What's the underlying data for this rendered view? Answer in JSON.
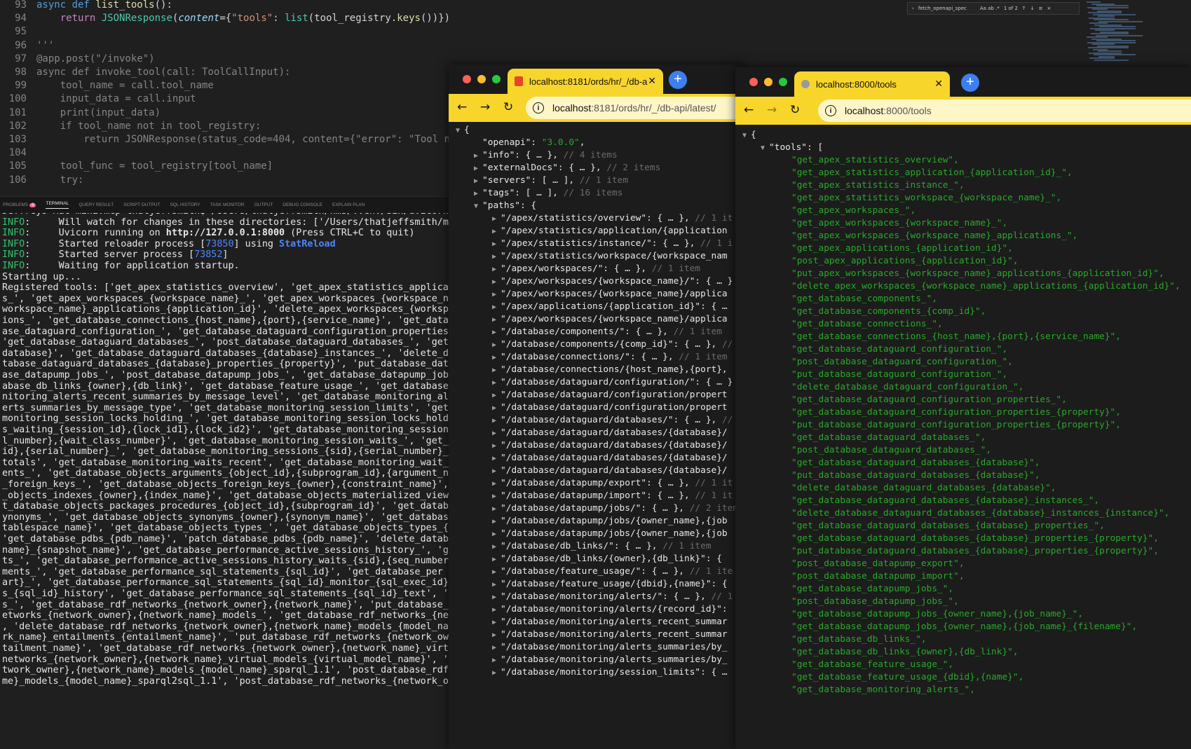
{
  "editor": {
    "lines": [
      {
        "n": "93",
        "html": "<span class=\"kw\">async def</span> <span class=\"fn\">list_tools</span>():"
      },
      {
        "n": "94",
        "html": "    <span class=\"kwc\">return</span> <span class=\"cls\">JSONResponse</span>(<span class=\"param\">content</span>={<span class=\"str\">\"tools\"</span>: <span class=\"cls\">list</span>(tool_registry.<span class=\"fn\">keys</span>())})"
      },
      {
        "n": "95",
        "html": ""
      },
      {
        "n": "96",
        "html": "<span class=\"dim\">'''</span>"
      },
      {
        "n": "97",
        "html": "<span class=\"dim\">@app.post(\"/invoke\")</span>"
      },
      {
        "n": "98",
        "html": "<span class=\"dim\">async def invoke_tool(call: ToolCallInput):</span>"
      },
      {
        "n": "99",
        "html": "<span class=\"dim\">    tool_name = call.tool_name</span>"
      },
      {
        "n": "100",
        "html": "<span class=\"dim\">    input_data = call.input</span>"
      },
      {
        "n": "101",
        "html": "<span class=\"dim\">    print(input_data)</span>"
      },
      {
        "n": "102",
        "html": "<span class=\"dim\">    if tool_name not in tool_registry:</span>"
      },
      {
        "n": "103",
        "html": "<span class=\"dim\">        return JSONResponse(status_code=404, content={\"error\": \"Tool n</span>"
      },
      {
        "n": "104",
        "html": ""
      },
      {
        "n": "105",
        "html": "<span class=\"dim\">    tool_func = tool_registry[tool_name]</span>"
      },
      {
        "n": "106",
        "html": "<span class=\"dim\">    try:</span>"
      }
    ],
    "find": {
      "query": "fetch_openapi_spec",
      "options": "Aa  ab  .*",
      "count": "1 of 2"
    }
  },
  "panel": {
    "tabs": [
      "PROBLEMS",
      "TERMINAL",
      "QUERY RESULT",
      "SCRIPT OUTPUT",
      "SQL HISTORY",
      "TASK MONITOR",
      "OUTPUT",
      "DEBUG CONSOLE",
      "EXPLAIN PLAN"
    ],
    "problems_count": "9",
    "active": "TERMINAL"
  },
  "terminal": {
    "lines": [
      "Jeffreys-Mac-mini:mcp thatjeffsmith$ /Users/thatjeffsmith/hms/.venv/bin/uvicorn",
      "<span class=\"green\">INFO</span>:     Will watch for changes in these directories: ['/Users/thatjeffsmith/m",
      "<span class=\"green\">INFO</span>:     Uvicorn running on <span class=\"bold\">http://127.0.0.1:8000</span> (Press CTRL+C to quit)",
      "<span class=\"green\">INFO</span>:     Started reloader process [<span class=\"blue\">73850</span>] using <span class=\"blue bold\">StatReload</span>",
      "<span class=\"green\">INFO</span>:     Started server process [<span class=\"blue\">73852</span>]",
      "<span class=\"green\">INFO</span>:     Waiting for application startup.",
      "Starting up...",
      "Registered tools: ['get_apex_statistics_overview', 'get_apex_statistics_applica",
      "s_', 'get_apex_workspaces_{workspace_name}_', 'get_apex_workspaces_{workspace_n",
      "workspace_name}_applications_{application_id}', 'delete_apex_workspaces_{worksp",
      "ions_', 'get_database_connections_{host_name},{port},{service_name}', 'get_data",
      "ase_dataguard_configuration_', 'get_database_dataguard_configuration_properties",
      "'get_database_dataguard_databases_', 'post_database_dataguard_databases_', 'get",
      "database}', 'get_database_dataguard_databases_{database}_instances_', 'delete_d",
      "tabase_dataguard_databases_{database}_properties_{property}', 'put_database_dat",
      "ase_datapump_jobs_', 'post_database_datapump_jobs_', 'get_database_datapump_job",
      "abase_db_links_{owner},{db_link}', 'get_database_feature_usage_', 'get_database",
      "nitoring_alerts_recent_summaries_by_message_level', 'get_database_monitoring_al",
      "erts_summaries_by_message_type', 'get_database_monitoring_session_limits', 'get",
      "monitoring_session_locks_holding_', 'get_database_monitoring_session_locks_hold",
      "s_waiting_{session_id},{lock_id1},{lock_id2}', 'get_database_monitoring_session",
      "l_number},{wait_class_number}', 'get_database_monitoring_session_waits_', 'get_",
      "id},{serial_number}_', 'get_database_monitoring_sessions_{sid},{serial_number}_",
      "totals', 'get_database_monitoring_waits_recent', 'get_database_monitoring_wait_",
      "ents_', 'get_database_objects_arguments_{object_id},{subprogram_id},{argument_n",
      "_foreign_keys_', 'get_database_objects_foreign_keys_{owner},{constraint_name}',",
      "_objects_indexes_{owner},{index_name}', 'get_database_objects_materialized_view",
      "t_database_objects_packages_procedures_{object_id},{subprogram_id}', 'get_datab",
      "ynonyms_', 'get_database_objects_synonyms_{owner},{synonym_name}', 'get_databas",
      "tablespace_name}', 'get_database_objects_types_', 'get_database_objects_types_{",
      "'get_database_pdbs_{pdb_name}', 'patch_database_pdbs_{pdb_name}', 'delete_datab",
      "name}_{snapshot_name}', 'get_database_performance_active_sessions_history_', 'g",
      "ts_', 'get_database_performance_active_sessions_history_waits_{sid},{seq_number",
      "ments_', 'get_database_performance_sql_statements_{sql_id}', 'get_database_per",
      "art}_', 'get_database_performance_sql_statements_{sql_id}_monitor_{sql_exec_id}",
      "s_{sql_id}_history', 'get_database_performance_sql_statements_{sql_id}_text', '",
      "s_', 'get_database_rdf_networks_{network_owner},{network_name}', 'put_database_",
      "etworks_{network_owner},{network_name}_models_', 'get_database_rdf_networks_{ne",
      ", 'delete_database_rdf_networks_{network_owner},{network_name}_models_{model_na",
      "rk_name}_entailments_{entailment_name}', 'put_database_rdf_networks_{network_ow",
      "tailment_name}', 'get_database_rdf_networks_{network_owner},{network_name}_virt",
      "networks_{network_owner},{network_name}_virtual_models_{virtual_model_name}', '",
      "twork_owner},{network_name}_models_{model_name}_sparql_1.1', 'post_database_rdf",
      "me}_models_{model_name}_sparql2sql_1.1', 'post_database_rdf_networks_{network_o"
    ]
  },
  "browser1": {
    "tab_title": "localhost:8181/ords/hr/_/db-a",
    "url_host": "localhost",
    "url_rest": ":8181/ords/hr/_/db-api/latest/",
    "json_lines": [
      {
        "t": "▼",
        "i": 0,
        "html": "{"
      },
      {
        "t": "",
        "i": 1,
        "html": "\"openapi\": <span class=\"js\">\"3.0.0\"</span>,"
      },
      {
        "t": "▶",
        "i": 1,
        "html": "\"info\": { … }, <span class=\"jc\">// 4 items</span>"
      },
      {
        "t": "▶",
        "i": 1,
        "html": "\"externalDocs\": { … }, <span class=\"jc\">// 2 items</span>"
      },
      {
        "t": "▶",
        "i": 1,
        "html": "\"servers\": [ … ], <span class=\"jc\">// 1 item</span>"
      },
      {
        "t": "▶",
        "i": 1,
        "html": "\"tags\": [ … ], <span class=\"jc\">// 16 items</span>"
      },
      {
        "t": "▼",
        "i": 1,
        "html": "\"paths\": {"
      },
      {
        "t": "▶",
        "i": 2,
        "html": "\"/apex/statistics/overview\": { … }, <span class=\"jc\">// 1 it</span>"
      },
      {
        "t": "▶",
        "i": 2,
        "html": "\"/apex/statistics/application/{application"
      },
      {
        "t": "▶",
        "i": 2,
        "html": "\"/apex/statistics/instance/\": { … }, <span class=\"jc\">// 1 i</span>"
      },
      {
        "t": "▶",
        "i": 2,
        "html": "\"/apex/statistics/workspace/{workspace_nam"
      },
      {
        "t": "▶",
        "i": 2,
        "html": "\"/apex/workspaces/\": { … }, <span class=\"jc\">// 1 item</span>"
      },
      {
        "t": "▶",
        "i": 2,
        "html": "\"/apex/workspaces/{workspace_name}/\": { … }"
      },
      {
        "t": "▶",
        "i": 2,
        "html": "\"/apex/workspaces/{workspace_name}/applica"
      },
      {
        "t": "▶",
        "i": 2,
        "html": "\"/apex/applications/{application_id}\": { …"
      },
      {
        "t": "▶",
        "i": 2,
        "html": "\"/apex/workspaces/{workspace_name}/applica"
      },
      {
        "t": "▶",
        "i": 2,
        "html": "\"/database/components/\": { … }, <span class=\"jc\">// 1 item</span>"
      },
      {
        "t": "▶",
        "i": 2,
        "html": "\"/database/components/{comp_id}\": { … }, <span class=\"jc\">//</span>"
      },
      {
        "t": "▶",
        "i": 2,
        "html": "\"/database/connections/\": { … }, <span class=\"jc\">// 1 item</span>"
      },
      {
        "t": "▶",
        "i": 2,
        "html": "\"/database/connections/{host_name},{port},"
      },
      {
        "t": "▶",
        "i": 2,
        "html": "\"/database/dataguard/configuration/\": { … }"
      },
      {
        "t": "▶",
        "i": 2,
        "html": "\"/database/dataguard/configuration/propert"
      },
      {
        "t": "▶",
        "i": 2,
        "html": "\"/database/dataguard/configuration/propert"
      },
      {
        "t": "▶",
        "i": 2,
        "html": "\"/database/dataguard/databases/\": { … }, <span class=\"jc\">//</span>"
      },
      {
        "t": "▶",
        "i": 2,
        "html": "\"/database/dataguard/databases/{database}/"
      },
      {
        "t": "▶",
        "i": 2,
        "html": "\"/database/dataguard/databases/{database}/"
      },
      {
        "t": "▶",
        "i": 2,
        "html": "\"/database/dataguard/databases/{database}/"
      },
      {
        "t": "▶",
        "i": 2,
        "html": "\"/database/dataguard/databases/{database}/"
      },
      {
        "t": "▶",
        "i": 2,
        "html": "\"/database/datapump/export\": { … }, <span class=\"jc\">// 1 it</span>"
      },
      {
        "t": "▶",
        "i": 2,
        "html": "\"/database/datapump/import\": { … }, <span class=\"jc\">// 1 it</span>"
      },
      {
        "t": "▶",
        "i": 2,
        "html": "\"/database/datapump/jobs/\": { … }, <span class=\"jc\">// 2 item</span>"
      },
      {
        "t": "▶",
        "i": 2,
        "html": "\"/database/datapump/jobs/{owner_name},{job"
      },
      {
        "t": "▶",
        "i": 2,
        "html": "\"/database/datapump/jobs/{owner_name},{job"
      },
      {
        "t": "▶",
        "i": 2,
        "html": "\"/database/db_links/\": { … }, <span class=\"jc\">// 1 item</span>"
      },
      {
        "t": "▶",
        "i": 2,
        "html": "\"/database/db_links/{owner},{db_link}\": {"
      },
      {
        "t": "▶",
        "i": 2,
        "html": "\"/database/feature_usage/\": { … }, <span class=\"jc\">// 1 ite</span>"
      },
      {
        "t": "▶",
        "i": 2,
        "html": "\"/database/feature_usage/{dbid},{name}\": {"
      },
      {
        "t": "▶",
        "i": 2,
        "html": "\"/database/monitoring/alerts/\": { … }, <span class=\"jc\">// 1</span>"
      },
      {
        "t": "▶",
        "i": 2,
        "html": "\"/database/monitoring/alerts/{record_id}\":"
      },
      {
        "t": "▶",
        "i": 2,
        "html": "\"/database/monitoring/alerts_recent_summar"
      },
      {
        "t": "▶",
        "i": 2,
        "html": "\"/database/monitoring/alerts_recent_summar"
      },
      {
        "t": "▶",
        "i": 2,
        "html": "\"/database/monitoring/alerts_summaries/by_"
      },
      {
        "t": "▶",
        "i": 2,
        "html": "\"/database/monitoring/alerts_summaries/by_"
      },
      {
        "t": "▶",
        "i": 2,
        "html": "\"/database/monitoring/session_limits\": { …"
      }
    ]
  },
  "browser2": {
    "tab_title": "localhost:8000/tools",
    "url_host": "localhost",
    "url_rest": ":8000/tools",
    "root_open": "{",
    "tools_key": "\"tools\": [",
    "tools": [
      "get_apex_statistics_overview",
      "get_apex_statistics_application_{application_id}_",
      "get_apex_statistics_instance_",
      "get_apex_statistics_workspace_{workspace_name}_",
      "get_apex_workspaces_",
      "get_apex_workspaces_{workspace_name}_",
      "get_apex_workspaces_{workspace_name}_applications_",
      "get_apex_applications_{application_id}",
      "post_apex_applications_{application_id}",
      "put_apex_workspaces_{workspace_name}_applications_{application_id}",
      "delete_apex_workspaces_{workspace_name}_applications_{application_id}",
      "get_database_components_",
      "get_database_components_{comp_id}",
      "get_database_connections_",
      "get_database_connections_{host_name},{port},{service_name}",
      "get_database_dataguard_configuration_",
      "post_database_dataguard_configuration_",
      "put_database_dataguard_configuration_",
      "delete_database_dataguard_configuration_",
      "get_database_dataguard_configuration_properties_",
      "get_database_dataguard_configuration_properties_{property}",
      "put_database_dataguard_configuration_properties_{property}",
      "get_database_dataguard_databases_",
      "post_database_dataguard_databases_",
      "get_database_dataguard_databases_{database}",
      "put_database_dataguard_databases_{database}",
      "delete_database_dataguard_databases_{database}",
      "get_database_dataguard_databases_{database}_instances_",
      "delete_database_dataguard_databases_{database}_instances_{instance}",
      "get_database_dataguard_databases_{database}_properties_",
      "get_database_dataguard_databases_{database}_properties_{property}",
      "put_database_dataguard_databases_{database}_properties_{property}",
      "post_database_datapump_export",
      "post_database_datapump_import",
      "get_database_datapump_jobs_",
      "post_database_datapump_jobs_",
      "get_database_datapump_jobs_{owner_name},{job_name}_",
      "get_database_datapump_jobs_{owner_name},{job_name}_{filename}",
      "get_database_db_links_",
      "get_database_db_links_{owner},{db_link}",
      "get_database_feature_usage_",
      "get_database_feature_usage_{dbid},{name}",
      "get_database_monitoring_alerts_"
    ]
  }
}
